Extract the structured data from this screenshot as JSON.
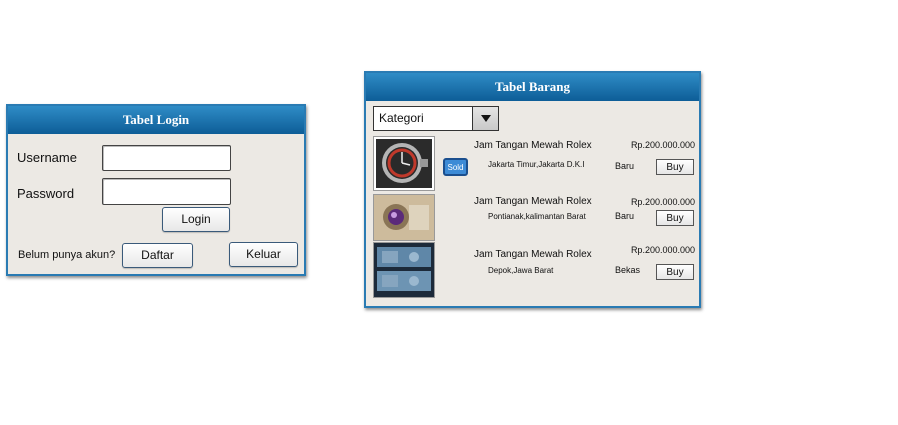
{
  "login": {
    "title": "Tabel Login",
    "username_label": "Username",
    "password_label": "Password",
    "login_button": "Login",
    "register_prompt": "Belum punya akun?",
    "register_button": "Daftar",
    "exit_button": "Keluar"
  },
  "barang": {
    "title": "Tabel Barang",
    "category_select": "Kategori",
    "sold_badge": "Sold",
    "items": [
      {
        "name": "Jam Tangan Mewah Rolex",
        "location": "Jakarta Timur,Jakarta D.K.I",
        "price": "Rp.200.000.000",
        "condition": "Baru",
        "buy": "Buy"
      },
      {
        "name": "Jam Tangan Mewah Rolex",
        "location": "Pontianak,kalimantan Barat",
        "price": "Rp.200.000.000",
        "condition": "Baru",
        "buy": "Buy"
      },
      {
        "name": "Jam Tangan Mewah Rolex",
        "location": "Depok,Jawa Barat",
        "price": "Rp.200.000.000",
        "condition": "Bekas",
        "buy": "Buy"
      }
    ]
  }
}
